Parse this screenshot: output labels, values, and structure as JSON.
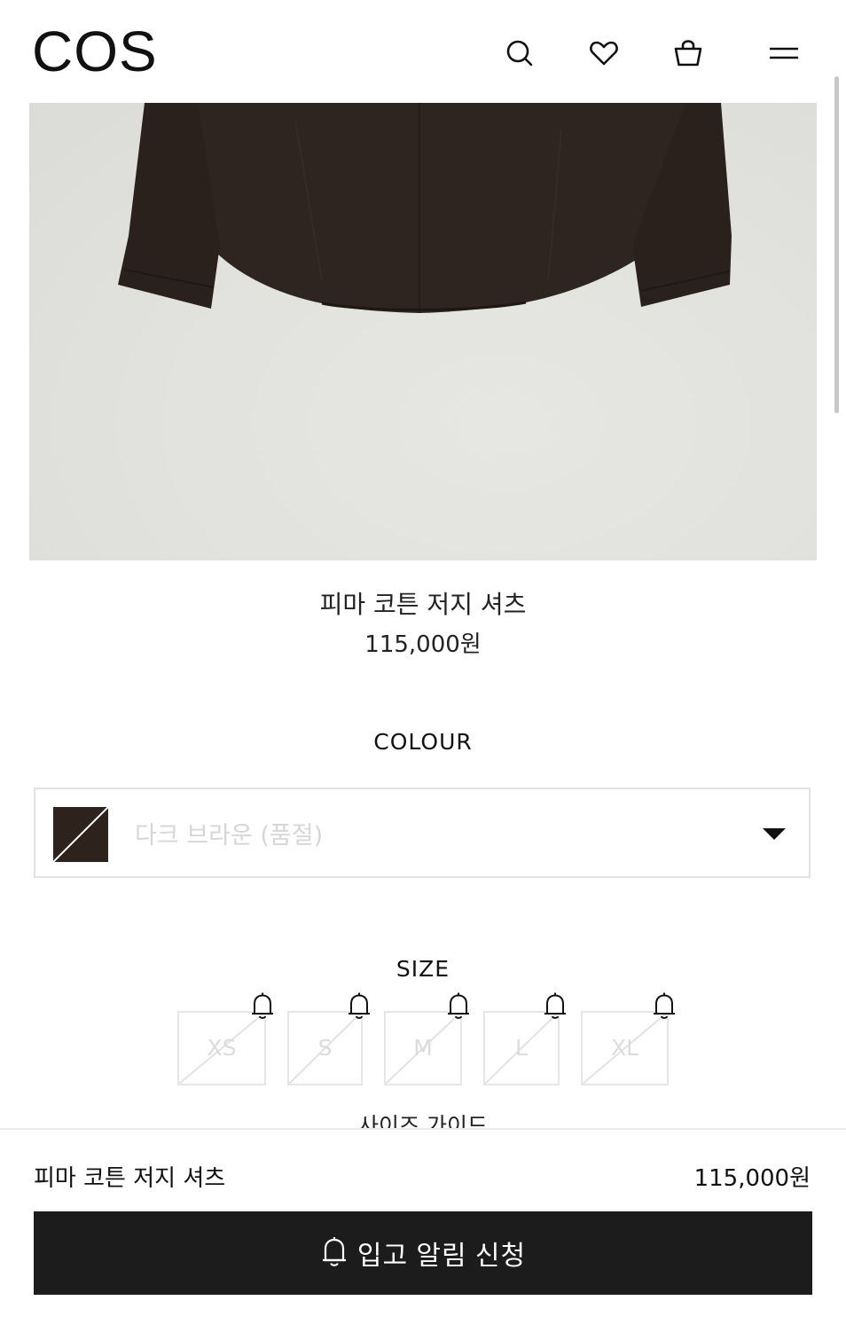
{
  "header": {
    "logo": "COS",
    "icons": [
      "search-icon",
      "heart-icon",
      "bag-icon",
      "menu-icon"
    ]
  },
  "product": {
    "name": "피마 코튼 저지 셔츠",
    "price": "115,000원"
  },
  "colour": {
    "label": "COLOUR",
    "selected": "다크 브라운 (품절)",
    "swatch_color": "#2e221d"
  },
  "size": {
    "label": "SIZE",
    "options": [
      "XS",
      "S",
      "M",
      "L",
      "XL"
    ],
    "guide_label": "사이즈 가이드"
  },
  "bottom_bar": {
    "name": "피마 코튼 저지 셔츠",
    "price": "115,000원",
    "button_label": "입고 알림 신청"
  }
}
